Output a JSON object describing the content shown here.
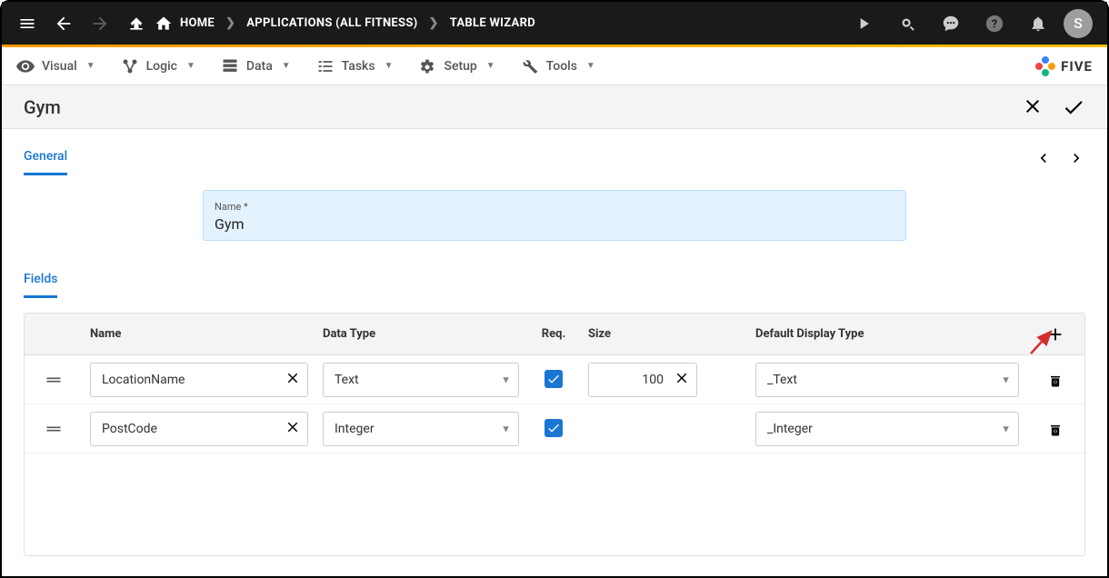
{
  "topbar": {
    "breadcrumbs": [
      {
        "label": "HOME"
      },
      {
        "label": "APPLICATIONS (ALL FITNESS)"
      },
      {
        "label": "TABLE WIZARD"
      }
    ],
    "avatar": "S"
  },
  "menubar": {
    "items": [
      {
        "label": "Visual"
      },
      {
        "label": "Logic"
      },
      {
        "label": "Data"
      },
      {
        "label": "Tasks"
      },
      {
        "label": "Setup"
      },
      {
        "label": "Tools"
      }
    ],
    "brand": "FIVE"
  },
  "header": {
    "title": "Gym"
  },
  "tabs": {
    "general": "General",
    "fields": "Fields"
  },
  "form": {
    "name": {
      "label": "Name *",
      "value": "Gym"
    }
  },
  "table": {
    "columns": {
      "name": "Name",
      "dataType": "Data Type",
      "req": "Req.",
      "size": "Size",
      "displayType": "Default Display Type"
    },
    "rows": [
      {
        "name": "LocationName",
        "dataType": "Text",
        "req": true,
        "size": "100",
        "displayType": "_Text"
      },
      {
        "name": "PostCode",
        "dataType": "Integer",
        "req": true,
        "size": "",
        "displayType": "_Integer"
      }
    ]
  }
}
